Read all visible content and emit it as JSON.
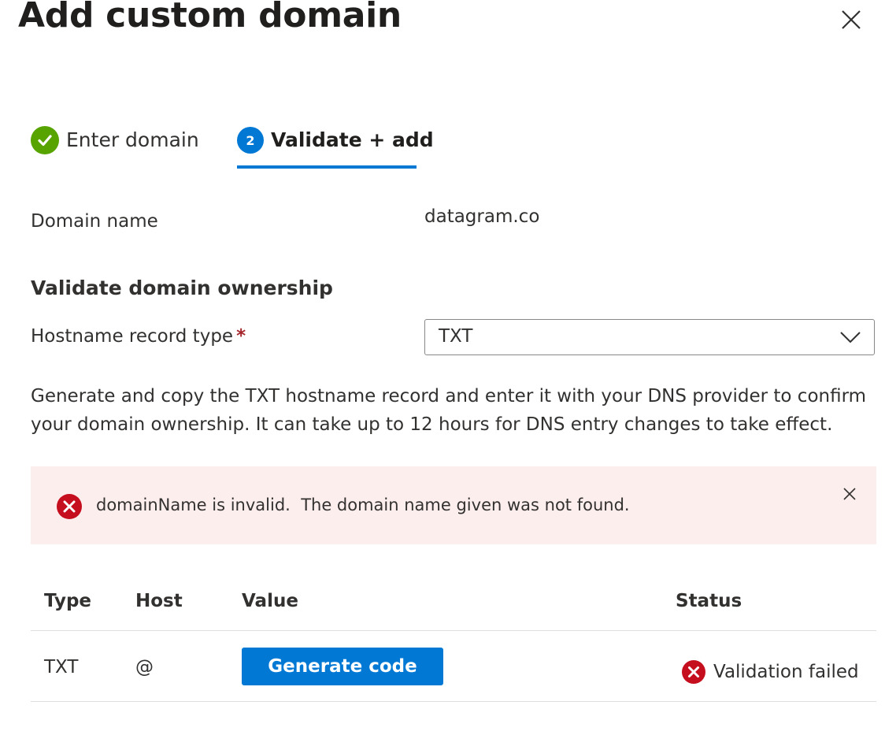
{
  "dialog": {
    "title": "Add custom domain"
  },
  "steps": [
    {
      "label": "Enter domain",
      "state": "completed"
    },
    {
      "number": "2",
      "label": "Validate + add",
      "state": "current"
    }
  ],
  "domain": {
    "label": "Domain name",
    "value": "datagram.co"
  },
  "validation": {
    "section_title": "Validate domain ownership",
    "record_type_label": "Hostname record type",
    "required_marker": "*",
    "record_type_value": "TXT",
    "description": "Generate and copy the TXT hostname record and enter it with your DNS provider to confirm your domain ownership. It can take up to 12 hours for DNS entry changes to take effect."
  },
  "error": {
    "message": "domainName is invalid.  The domain name given was not found."
  },
  "table": {
    "columns": [
      "Type",
      "Host",
      "Value",
      "Status"
    ],
    "rows": [
      {
        "type": "TXT",
        "host": "@",
        "button_label": "Generate code",
        "status": "Validation failed"
      }
    ]
  },
  "colors": {
    "accent": "#0078d4",
    "success": "#57a300",
    "error": "#c50f1f",
    "error_background": "#fdeeee"
  },
  "icons": {
    "close": "close-icon",
    "step_done": "checkmark-circle-icon",
    "dropdown": "chevron-down-icon",
    "error": "error-circle-icon"
  }
}
